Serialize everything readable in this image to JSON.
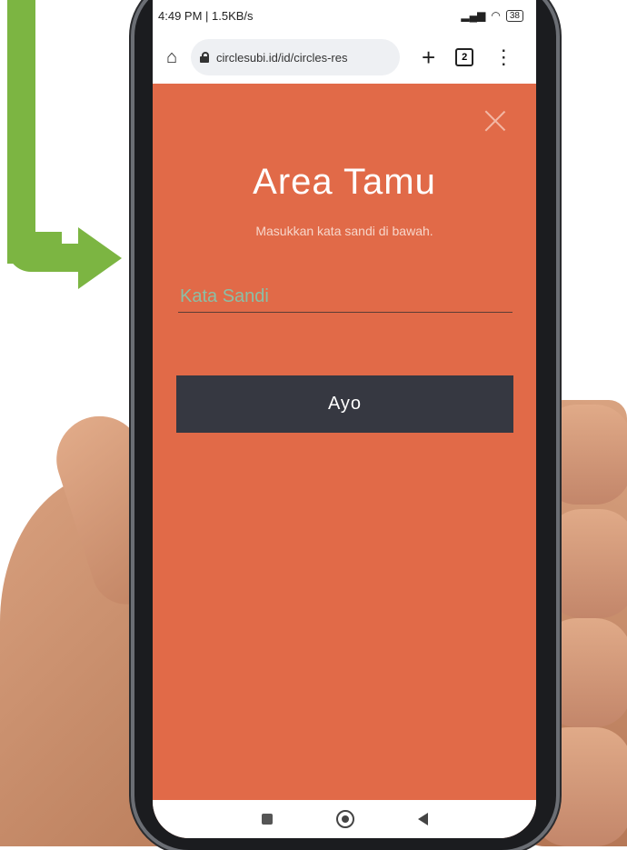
{
  "status_bar": {
    "time_speed": "4:49 PM | 1.5KB/s",
    "battery": "38"
  },
  "browser": {
    "url": "circlesubi.id/id/circles-res",
    "tab_count": "2"
  },
  "page": {
    "title": "Area Tamu",
    "subtitle": "Masukkan kata sandi di bawah.",
    "password_placeholder": "Kata Sandi",
    "submit_label": "Ayo"
  },
  "colors": {
    "background": "#e16a48",
    "button": "#363841",
    "arrow": "#7cb542"
  }
}
